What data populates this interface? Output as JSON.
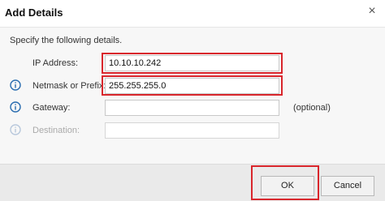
{
  "dialog": {
    "title": "Add Details",
    "close_glyph": "×",
    "instruction": "Specify the following details."
  },
  "fields": [
    {
      "label": "IP Address:",
      "value": "10.10.10.242",
      "icon": "",
      "enabled": true
    },
    {
      "label": "Netmask or Prefix:",
      "value": "255.255.255.0",
      "icon": "info-icon",
      "enabled": true
    },
    {
      "label": "Gateway:",
      "value": "",
      "icon": "info-icon",
      "enabled": true,
      "suffix": "(optional)"
    },
    {
      "label": "Destination:",
      "value": "",
      "icon": "info-icon",
      "enabled": false
    }
  ],
  "buttons": {
    "ok": "OK",
    "cancel": "Cancel"
  },
  "colors": {
    "highlight": "#d9262c",
    "info_icon": "#2a6db0"
  }
}
